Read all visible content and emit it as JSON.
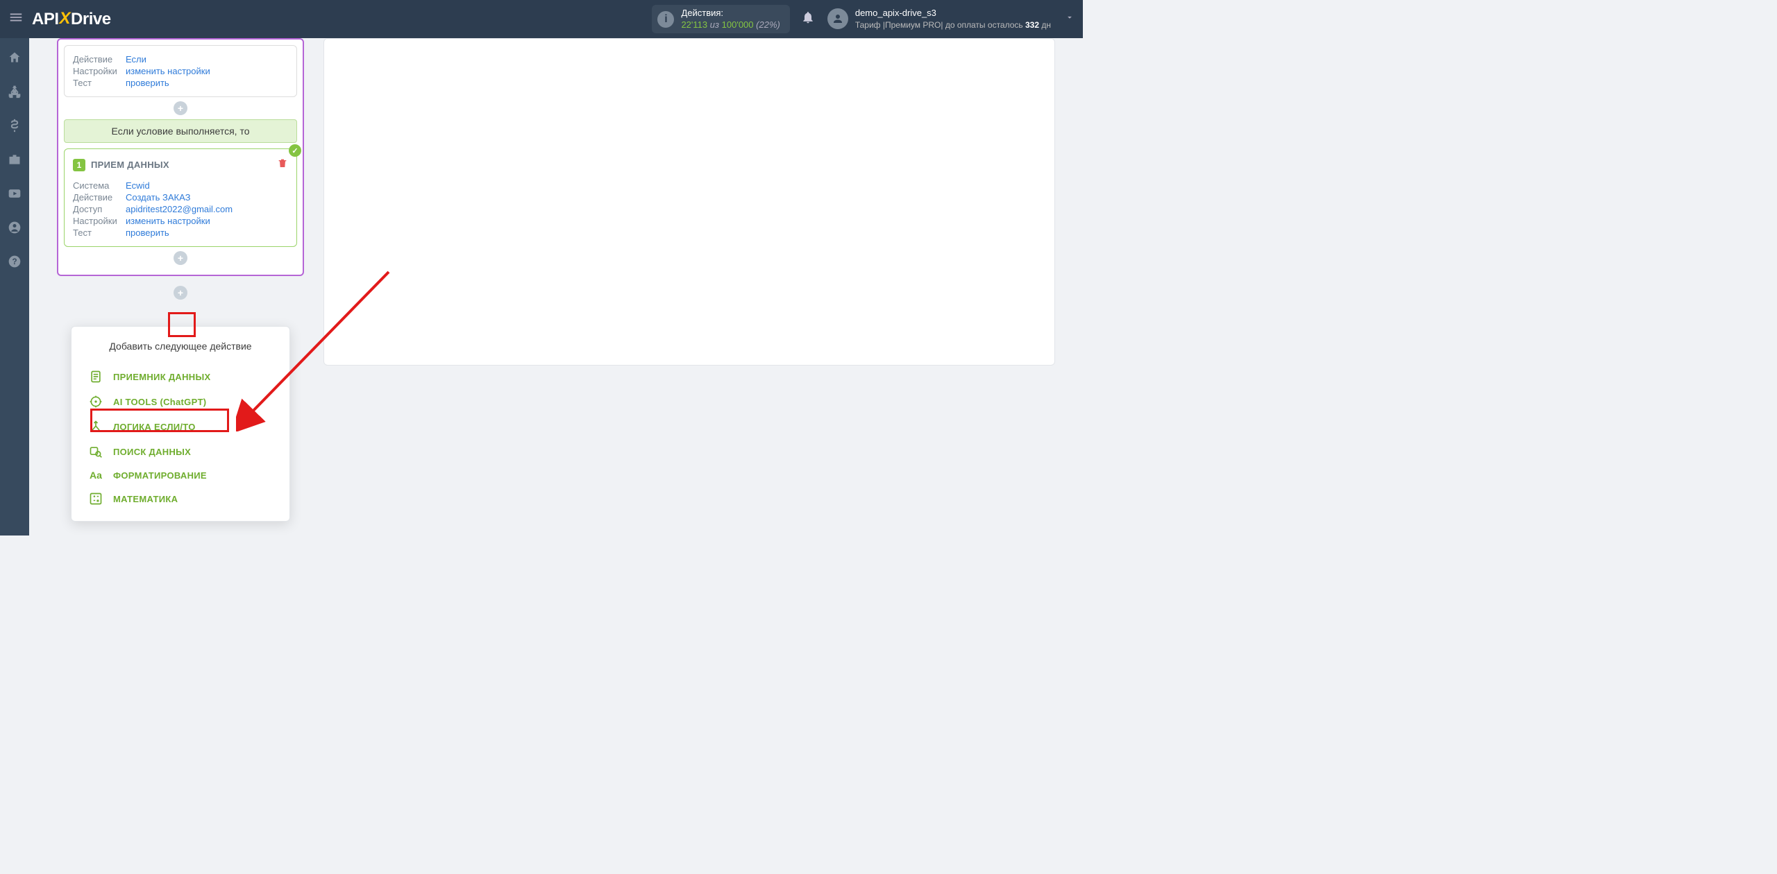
{
  "header": {
    "logo_pre": "API",
    "logo_x": "X",
    "logo_post": "Drive",
    "actions_label": "Действия:",
    "actions_used": "22'113",
    "actions_iz": "из",
    "actions_total": "100'000",
    "actions_pct": "(22%)",
    "username": "demo_apix-drive_s3",
    "tariff_prefix": "Тариф |Премиум PRO| до оплаты осталось ",
    "tariff_days": "332",
    "tariff_suffix": " дн"
  },
  "card1": {
    "r1_lbl": "Действие",
    "r1_val": "Если",
    "r2_lbl": "Настройки",
    "r2_val": "изменить настройки",
    "r3_lbl": "Тест",
    "r3_val": "проверить"
  },
  "cond_bar": "Если условие выполняется, то",
  "recv": {
    "num": "1",
    "title": "ПРИЕМ ДАННЫХ",
    "r1_lbl": "Система",
    "r1_val": "Ecwid",
    "r2_lbl": "Действие",
    "r2_val": "Создать ЗАКАЗ",
    "r3_lbl": "Доступ",
    "r3_val": "apidritest2022@gmail.com",
    "r4_lbl": "Настройки",
    "r4_val": "изменить настройки",
    "r5_lbl": "Тест",
    "r5_val": "проверить"
  },
  "popup": {
    "title": "Добавить следующее действие",
    "items": [
      "ПРИЕМНИК ДАННЫХ",
      "AI TOOLS (ChatGPT)",
      "ЛОГИКА ЕСЛИ/ТО",
      "ПОИСК ДАННЫХ",
      "ФОРМАТИРОВАНИЕ",
      "МАТЕМАТИКА"
    ]
  }
}
